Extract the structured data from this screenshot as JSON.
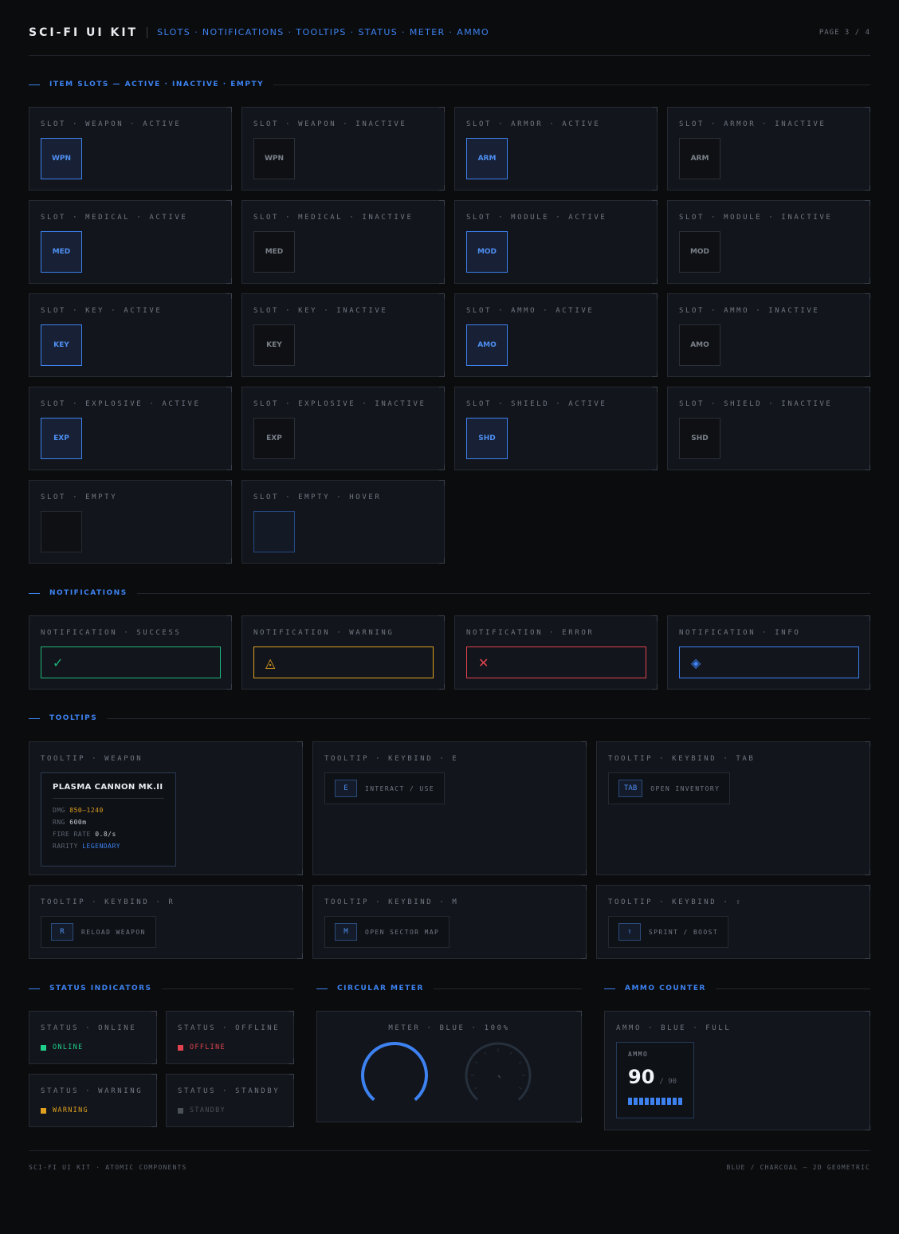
{
  "header": {
    "title": "SCI-FI UI KIT",
    "subtitle": "SLOTS · NOTIFICATIONS · TOOLTIPS · STATUS · METER · AMMO",
    "page": "PAGE 3 / 4"
  },
  "sections": {
    "slots": "ITEM SLOTS — ACTIVE · INACTIVE · EMPTY",
    "notifications": "NOTIFICATIONS",
    "tooltips": "TOOLTIPS",
    "status": "STATUS INDICATORS",
    "meter": "CIRCULAR METER",
    "ammo": "AMMO COUNTER"
  },
  "slots": [
    {
      "label": "SLOT · WEAPON · ACTIVE",
      "code": "WPN",
      "state": "active"
    },
    {
      "label": "SLOT · WEAPON · INACTIVE",
      "code": "WPN",
      "state": "inactive"
    },
    {
      "label": "SLOT · ARMOR · ACTIVE",
      "code": "ARM",
      "state": "active"
    },
    {
      "label": "SLOT · ARMOR · INACTIVE",
      "code": "ARM",
      "state": "inactive"
    },
    {
      "label": "SLOT · MEDICAL · ACTIVE",
      "code": "MED",
      "state": "active"
    },
    {
      "label": "SLOT · MEDICAL · INACTIVE",
      "code": "MED",
      "state": "inactive"
    },
    {
      "label": "SLOT · MODULE · ACTIVE",
      "code": "MOD",
      "state": "active"
    },
    {
      "label": "SLOT · MODULE · INACTIVE",
      "code": "MOD",
      "state": "inactive"
    },
    {
      "label": "SLOT · KEY · ACTIVE",
      "code": "KEY",
      "state": "active"
    },
    {
      "label": "SLOT · KEY · INACTIVE",
      "code": "KEY",
      "state": "inactive"
    },
    {
      "label": "SLOT · AMMO · ACTIVE",
      "code": "AMO",
      "state": "active"
    },
    {
      "label": "SLOT · AMMO · INACTIVE",
      "code": "AMO",
      "state": "inactive"
    },
    {
      "label": "SLOT · EXPLOSIVE · ACTIVE",
      "code": "EXP",
      "state": "active"
    },
    {
      "label": "SLOT · EXPLOSIVE · INACTIVE",
      "code": "EXP",
      "state": "inactive"
    },
    {
      "label": "SLOT · SHIELD · ACTIVE",
      "code": "SHD",
      "state": "active"
    },
    {
      "label": "SLOT · SHIELD · INACTIVE",
      "code": "SHD",
      "state": "inactive"
    },
    {
      "label": "SLOT · EMPTY",
      "code": "",
      "state": "empty"
    },
    {
      "label": "SLOT · EMPTY · HOVER",
      "code": "",
      "state": "hover"
    }
  ],
  "notifications": [
    {
      "label": "NOTIFICATION · SUCCESS",
      "glyph": "✓",
      "icon": "check-icon",
      "color": "#1fb57a"
    },
    {
      "label": "NOTIFICATION · WARNING",
      "glyph": "◬",
      "icon": "warning-icon",
      "color": "#e0a020"
    },
    {
      "label": "NOTIFICATION · ERROR",
      "glyph": "✕",
      "icon": "error-icon",
      "color": "#e0434f"
    },
    {
      "label": "NOTIFICATION · INFO",
      "glyph": "◈",
      "icon": "info-icon",
      "color": "#3d82f0"
    }
  ],
  "tooltip_weapon": {
    "label": "TOOLTIP · WEAPON",
    "name": "PLASMA CANNON MK.II",
    "stats": [
      {
        "key": "DMG",
        "value": "850–1240",
        "color": "#e0a020"
      },
      {
        "key": "RNG",
        "value": "600m",
        "color": "#c9ced6"
      },
      {
        "key": "FIRE RATE",
        "value": "0.8/s",
        "color": "#c9ced6"
      },
      {
        "key": "RARITY",
        "value": "LEGENDARY",
        "color": "#3d82f0"
      }
    ]
  },
  "keybinds": [
    {
      "label": "TOOLTIP · KEYBIND · E",
      "key": "E",
      "action": "INTERACT / USE"
    },
    {
      "label": "TOOLTIP · KEYBIND · TAB",
      "key": "TAB",
      "action": "OPEN INVENTORY"
    },
    {
      "label": "TOOLTIP · KEYBIND · R",
      "key": "R",
      "action": "RELOAD WEAPON"
    },
    {
      "label": "TOOLTIP · KEYBIND · M",
      "key": "M",
      "action": "OPEN SECTOR MAP"
    },
    {
      "label": "TOOLTIP · KEYBIND · ⇧",
      "key": "⇧",
      "action": "SPRINT / BOOST"
    }
  ],
  "status": [
    {
      "label": "STATUS · ONLINE",
      "text": "ONLINE",
      "color": "#1fd08a"
    },
    {
      "label": "STATUS · OFFLINE",
      "text": "OFFLINE",
      "color": "#e0434f"
    },
    {
      "label": "STATUS · WARNING",
      "text": "WARNING",
      "color": "#e0a020"
    },
    {
      "label": "STATUS · STANDBY",
      "text": "STANDBY",
      "color": "#4a5058"
    }
  ],
  "meter": {
    "label": "METER · BLUE · 100%",
    "value_pct": 100,
    "color": "#3d82f0"
  },
  "ammo": {
    "label": "AMMO · BLUE · FULL",
    "title": "AMMO",
    "current": "90",
    "max": "/ 90",
    "fill": 1.0,
    "segments": 10
  },
  "footer": {
    "left": "SCI-FI UI KIT · ATOMIC COMPONENTS",
    "right": "BLUE / CHARCOAL — 2D GEOMETRIC"
  }
}
